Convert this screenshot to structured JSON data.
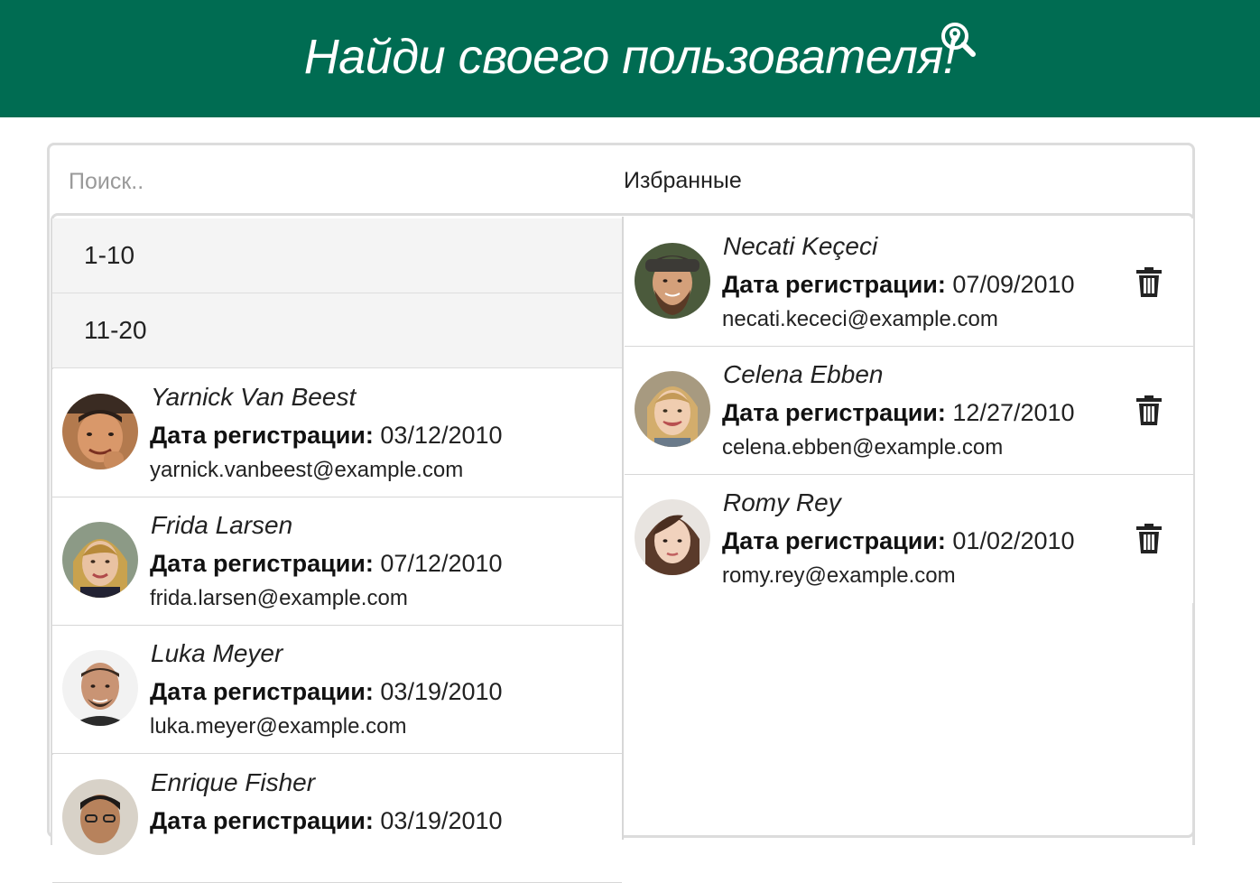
{
  "header": {
    "title": "Найди своего пользователя!",
    "icon": "search-location-icon"
  },
  "search": {
    "placeholder": "Поиск..",
    "value": ""
  },
  "favorites": {
    "title": "Избранные",
    "items": [
      {
        "name": "Necati Keçeci",
        "date_label": "Дата регистрации:",
        "date": "07/09/2010",
        "email": "necati.kececi@example.com"
      },
      {
        "name": "Celena Ebben",
        "date_label": "Дата регистрации:",
        "date": "12/27/2010",
        "email": "celena.ebben@example.com"
      },
      {
        "name": "Romy Rey",
        "date_label": "Дата регистрации:",
        "date": "01/02/2010",
        "email": "romy.rey@example.com"
      }
    ]
  },
  "groups": [
    {
      "label": "1-10"
    },
    {
      "label": "11-20"
    }
  ],
  "users": [
    {
      "name": "Yarnick Van Beest",
      "date_label": "Дата регистрации:",
      "date": "03/12/2010",
      "email": "yarnick.vanbeest@example.com"
    },
    {
      "name": "Frida Larsen",
      "date_label": "Дата регистрации:",
      "date": "07/12/2010",
      "email": "frida.larsen@example.com"
    },
    {
      "name": "Luka Meyer",
      "date_label": "Дата регистрации:",
      "date": "03/19/2010",
      "email": "luka.meyer@example.com"
    },
    {
      "name": "Enrique Fisher",
      "date_label": "Дата регистрации:",
      "date": "03/19/2010",
      "email": ""
    }
  ],
  "colors": {
    "header_bg": "#006c52",
    "header_text": "#ffffff",
    "group_bg": "#f4f4f4",
    "border": "#dcdcdc"
  }
}
